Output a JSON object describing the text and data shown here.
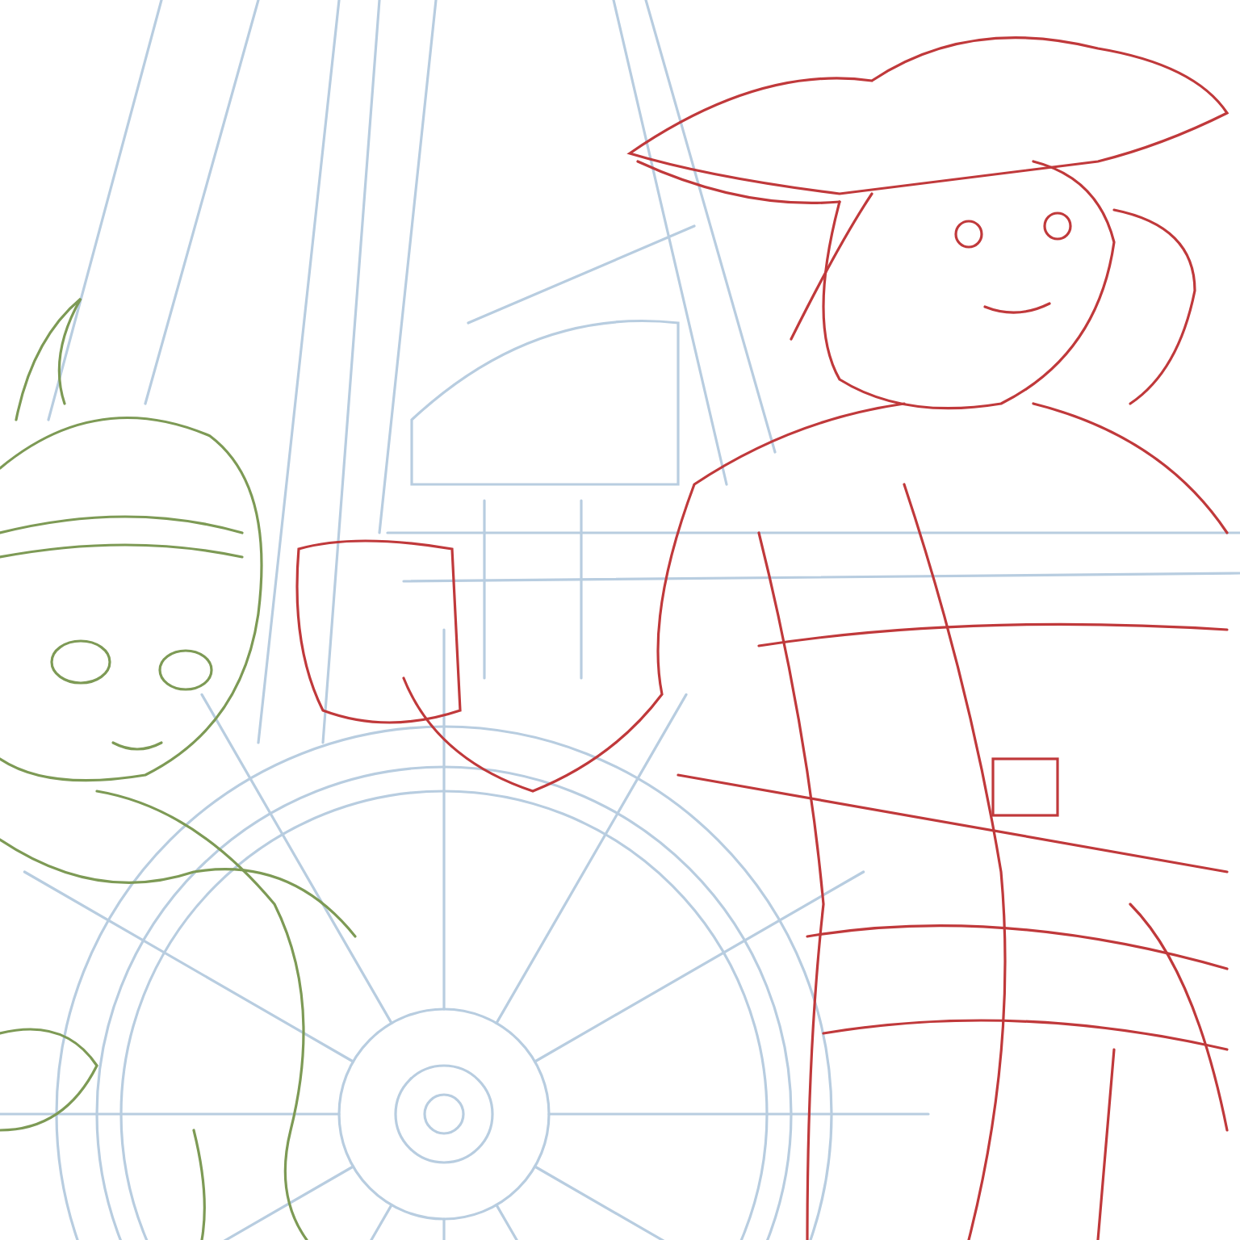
{
  "layers": [
    {
      "kind": "ship-wheel",
      "color": "#b8cde0"
    },
    {
      "kind": "pirate",
      "color": "#c0393b"
    },
    {
      "kind": "girl",
      "color": "#7d9a55"
    }
  ]
}
